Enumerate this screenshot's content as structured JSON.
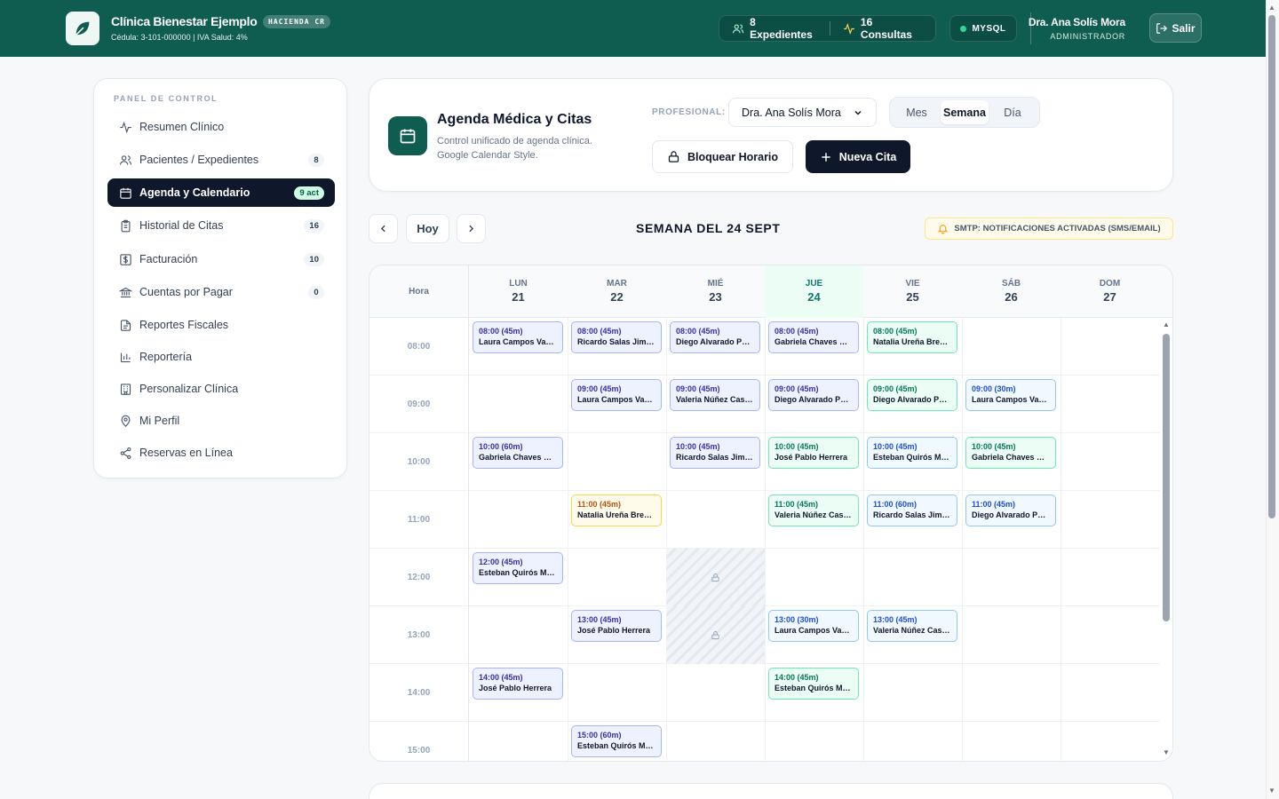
{
  "header": {
    "clinic_name": "Clínica Bienestar Ejemplo",
    "badge": "HACIENDA CR",
    "subtitle": "Cédula: 3-101-000000 | IVA Salud: 4%",
    "stats": [
      {
        "icon": "users-icon",
        "label": "8 Expedientes"
      },
      {
        "icon": "activity-icon",
        "label": "16 Consultas"
      }
    ],
    "db_label": "MYSQL",
    "user_name": "Dra. Ana Solís Mora",
    "user_role": "ADMINISTRADOR",
    "logout_label": "Salir",
    "brand_color": "#0f5c50"
  },
  "sidebar": {
    "title": "PANEL DE CONTROL",
    "items": [
      {
        "icon": "activity-icon",
        "label": "Resumen Clínico",
        "count": null,
        "active": false
      },
      {
        "icon": "users-icon",
        "label": "Pacientes / Expedientes",
        "count": "8",
        "active": false
      },
      {
        "icon": "calendar-icon",
        "label": "Agenda y Calendario",
        "count": "9 act",
        "active": true
      },
      {
        "icon": "clipboard-icon",
        "label": "Historial de Citas",
        "count": "16",
        "active": false
      },
      {
        "icon": "dollar-icon",
        "label": "Facturación",
        "count": "10",
        "active": false
      },
      {
        "icon": "bank-icon",
        "label": "Cuentas por Pagar",
        "count": "0",
        "active": false
      },
      {
        "icon": "file-icon",
        "label": "Reportes Fiscales",
        "count": null,
        "active": false
      },
      {
        "icon": "bar-chart-icon",
        "label": "Reportería",
        "count": null,
        "active": false
      },
      {
        "icon": "building-icon",
        "label": "Personalizar Clínica",
        "count": null,
        "active": false
      },
      {
        "icon": "map-pin-icon",
        "label": "Mi Perfil",
        "count": null,
        "active": false
      },
      {
        "icon": "share-icon",
        "label": "Reservas en Línea",
        "count": null,
        "active": false
      }
    ]
  },
  "agenda": {
    "title": "Agenda Médica y Citas",
    "description": "Control unificado de agenda clínica. Google Calendar Style.",
    "professional_label": "PROFESIONAL:",
    "professional_value": "Dra. Ana Solís Mora",
    "views": [
      {
        "label": "Mes",
        "active": false
      },
      {
        "label": "Semana",
        "active": true
      },
      {
        "label": "Día",
        "active": false
      }
    ],
    "block_button": "Bloquear Horario",
    "new_button": "Nueva Cita"
  },
  "week_nav": {
    "today_label": "Hoy",
    "title": "SEMANA DEL 24 SEPT",
    "smtp_label": "SMTP: NOTIFICACIONES ACTIVADAS (SMS/EMAIL)"
  },
  "calendar": {
    "hour_header": "Hora",
    "days": [
      {
        "name": "LUN",
        "num": "21",
        "today": false
      },
      {
        "name": "MAR",
        "num": "22",
        "today": false
      },
      {
        "name": "MIÉ",
        "num": "23",
        "today": false
      },
      {
        "name": "JUE",
        "num": "24",
        "today": true
      },
      {
        "name": "VIE",
        "num": "25",
        "today": false
      },
      {
        "name": "SÁB",
        "num": "26",
        "today": false
      },
      {
        "name": "DOM",
        "num": "27",
        "today": false
      }
    ],
    "hours": [
      "08:00",
      "09:00",
      "10:00",
      "11:00",
      "12:00",
      "13:00",
      "14:00",
      "15:00"
    ],
    "blocked_slots": [
      {
        "day": 2,
        "hour": 4
      },
      {
        "day": 2,
        "hour": 5
      }
    ],
    "appointments": [
      {
        "day": 0,
        "hour": 0,
        "time": "08:00 (45m)",
        "name": "Laura Campos Vargas",
        "color": "indigo"
      },
      {
        "day": 1,
        "hour": 0,
        "time": "08:00 (45m)",
        "name": "Ricardo Salas Jiménez",
        "color": "indigo"
      },
      {
        "day": 2,
        "hour": 0,
        "time": "08:00 (45m)",
        "name": "Diego Alvarado Pérez",
        "color": "indigo"
      },
      {
        "day": 3,
        "hour": 0,
        "time": "08:00 (45m)",
        "name": "Gabriela Chaves Soto",
        "color": "indigo"
      },
      {
        "day": 4,
        "hour": 0,
        "time": "08:00 (45m)",
        "name": "Natalia Ureña Brenes",
        "color": "green"
      },
      {
        "day": 1,
        "hour": 1,
        "time": "09:00 (45m)",
        "name": "Laura Campos Vargas",
        "color": "indigo"
      },
      {
        "day": 2,
        "hour": 1,
        "time": "09:00 (45m)",
        "name": "Valeria Núñez Castro",
        "color": "indigo"
      },
      {
        "day": 3,
        "hour": 1,
        "time": "09:00 (45m)",
        "name": "Diego Alvarado Pérez",
        "color": "indigo"
      },
      {
        "day": 4,
        "hour": 1,
        "time": "09:00 (45m)",
        "name": "Diego Alvarado Pérez",
        "color": "green"
      },
      {
        "day": 5,
        "hour": 1,
        "time": "09:00 (30m)",
        "name": "Laura Campos Vargas",
        "color": "blue"
      },
      {
        "day": 0,
        "hour": 2,
        "time": "10:00 (60m)",
        "name": "Gabriela Chaves Soto",
        "color": "indigo"
      },
      {
        "day": 2,
        "hour": 2,
        "time": "10:00 (45m)",
        "name": "Ricardo Salas Jiménez",
        "color": "indigo"
      },
      {
        "day": 3,
        "hour": 2,
        "time": "10:00 (45m)",
        "name": "José Pablo Herrera",
        "color": "green"
      },
      {
        "day": 4,
        "hour": 2,
        "time": "10:00 (45m)",
        "name": "Esteban Quirós Mora",
        "color": "blue"
      },
      {
        "day": 5,
        "hour": 2,
        "time": "10:00 (45m)",
        "name": "Gabriela Chaves Soto",
        "color": "green"
      },
      {
        "day": 1,
        "hour": 3,
        "time": "11:00 (45m)",
        "name": "Natalia Ureña Brenes",
        "color": "amber"
      },
      {
        "day": 3,
        "hour": 3,
        "time": "11:00 (45m)",
        "name": "Valeria Núñez Castro",
        "color": "green"
      },
      {
        "day": 4,
        "hour": 3,
        "time": "11:00 (60m)",
        "name": "Ricardo Salas Jiménez",
        "color": "blue"
      },
      {
        "day": 5,
        "hour": 3,
        "time": "11:00 (45m)",
        "name": "Diego Alvarado Pérez",
        "color": "blue"
      },
      {
        "day": 0,
        "hour": 4,
        "time": "12:00 (45m)",
        "name": "Esteban Quirós Mora",
        "color": "indigo"
      },
      {
        "day": 1,
        "hour": 5,
        "time": "13:00 (45m)",
        "name": "José Pablo Herrera",
        "color": "indigo"
      },
      {
        "day": 3,
        "hour": 5,
        "time": "13:00 (30m)",
        "name": "Laura Campos Vargas",
        "color": "blue"
      },
      {
        "day": 4,
        "hour": 5,
        "time": "13:00 (45m)",
        "name": "Valeria Núñez Castro",
        "color": "blue"
      },
      {
        "day": 0,
        "hour": 6,
        "time": "14:00 (45m)",
        "name": "José Pablo Herrera",
        "color": "indigo"
      },
      {
        "day": 3,
        "hour": 6,
        "time": "14:00 (45m)",
        "name": "Esteban Quirós Mora",
        "color": "green"
      },
      {
        "day": 1,
        "hour": 7,
        "time": "15:00 (60m)",
        "name": "Esteban Quirós Mora",
        "color": "indigo"
      }
    ]
  }
}
